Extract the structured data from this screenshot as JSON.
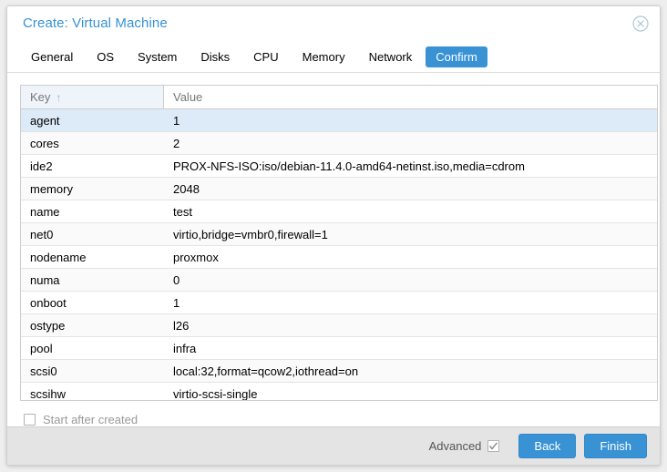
{
  "window": {
    "title": "Create: Virtual Machine",
    "close_icon": "close-circle-icon"
  },
  "tabs": [
    {
      "label": "General",
      "active": false
    },
    {
      "label": "OS",
      "active": false
    },
    {
      "label": "System",
      "active": false
    },
    {
      "label": "Disks",
      "active": false
    },
    {
      "label": "CPU",
      "active": false
    },
    {
      "label": "Memory",
      "active": false
    },
    {
      "label": "Network",
      "active": false
    },
    {
      "label": "Confirm",
      "active": true
    }
  ],
  "grid": {
    "columns": [
      {
        "label": "Key",
        "sort_indicator": "↑",
        "sorted": true
      },
      {
        "label": "Value",
        "sort_indicator": "",
        "sorted": false
      }
    ],
    "rows": [
      {
        "key": "agent",
        "value": "1",
        "selected": true
      },
      {
        "key": "cores",
        "value": "2",
        "selected": false
      },
      {
        "key": "ide2",
        "value": "PROX-NFS-ISO:iso/debian-11.4.0-amd64-netinst.iso,media=cdrom",
        "selected": false
      },
      {
        "key": "memory",
        "value": "2048",
        "selected": false
      },
      {
        "key": "name",
        "value": "test",
        "selected": false
      },
      {
        "key": "net0",
        "value": "virtio,bridge=vmbr0,firewall=1",
        "selected": false
      },
      {
        "key": "nodename",
        "value": "proxmox",
        "selected": false
      },
      {
        "key": "numa",
        "value": "0",
        "selected": false
      },
      {
        "key": "onboot",
        "value": "1",
        "selected": false
      },
      {
        "key": "ostype",
        "value": "l26",
        "selected": false
      },
      {
        "key": "pool",
        "value": "infra",
        "selected": false
      },
      {
        "key": "scsi0",
        "value": "local:32,format=qcow2,iothread=on",
        "selected": false
      },
      {
        "key": "scsihw",
        "value": "virtio-scsi-single",
        "selected": false
      }
    ]
  },
  "options": {
    "start_after_created": {
      "label": "Start after created",
      "checked": false
    }
  },
  "footer": {
    "advanced": {
      "label": "Advanced",
      "checked": true
    },
    "back_label": "Back",
    "finish_label": "Finish"
  },
  "colors": {
    "accent": "#3892d4",
    "title": "#3892d4",
    "selected_row": "#ddeaf7",
    "sorted_header": "#eef4fa",
    "footer_bg": "#e4e4e4"
  }
}
